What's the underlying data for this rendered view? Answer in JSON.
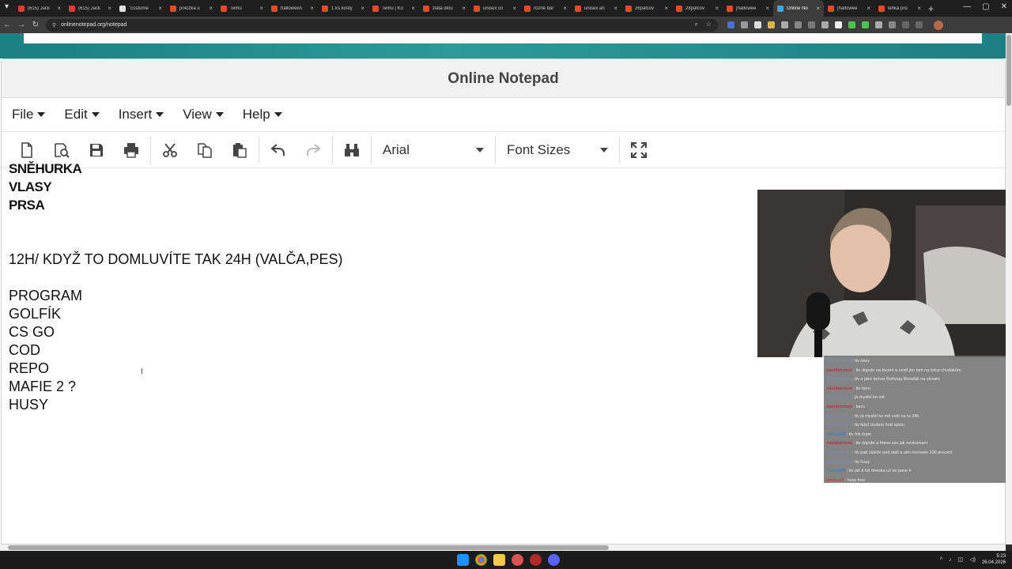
{
  "browser": {
    "tabs": [
      {
        "title": "(615) Jack",
        "color": "#e53935"
      },
      {
        "title": "(615) Jack",
        "color": "#e53935"
      },
      {
        "title": "\"costume",
        "color": "#e0e0e0"
      },
      {
        "title": "položka u",
        "color": "#e8472a"
      },
      {
        "title": "Temu",
        "color": "#e8472a"
      },
      {
        "title": "halloween",
        "color": "#e8472a"
      },
      {
        "title": "1 ks kostý",
        "color": "#e8472a"
      },
      {
        "title": "Temu | Ko",
        "color": "#e8472a"
      },
      {
        "title": "zlatá dlou",
        "color": "#e8472a"
      },
      {
        "title": "unisex co",
        "color": "#e8472a"
      },
      {
        "title": "různé bar",
        "color": "#e8472a"
      },
      {
        "title": "unisex an",
        "color": "#e8472a"
      },
      {
        "title": "26palcov",
        "color": "#e8472a"
      },
      {
        "title": "28palcov",
        "color": "#e8472a"
      },
      {
        "title": "[hallowee",
        "color": "#e8472a"
      },
      {
        "title": "Online No",
        "color": "#4aa3df",
        "active": true
      },
      {
        "title": "[hallowee",
        "color": "#e8472a"
      },
      {
        "title": "lehká pro",
        "color": "#e8472a"
      }
    ],
    "url": "onlinenotepad.org/notepad"
  },
  "notepad": {
    "title": "Online Notepad",
    "menu": [
      "File",
      "Edit",
      "Insert",
      "View",
      "Help"
    ],
    "font_select": "Arial",
    "size_select": "Font Sizes",
    "bold_lines": [
      "SNĚHURKA",
      "VLASY",
      "PRSA"
    ],
    "body_line": "12H/ KDYŽ TO DOMLUVÍTE TAK 24H (VALČA,PES)",
    "list": [
      "PROGRAM",
      "GOLFÍK",
      "CS GO",
      "COD",
      "REPO",
      "MAFIE 2 ?",
      "HUSY"
    ]
  },
  "chat": [
    {
      "user": "mrjohnskon",
      "msg": "ttv okey",
      "color": "#7a8ab0"
    },
    {
      "user": "davidekrizek",
      "msg": "ttv dojede na focení a uvidí jim tam na fotce chudákům",
      "color": "#c0304a"
    },
    {
      "user": "mrjohnskon",
      "msg": "ttv a jako bonus Bořivoja Blonďák na stream",
      "color": "#7a8ab0"
    },
    {
      "user": "davidekrizek",
      "msg": "ttv beru",
      "color": "#c0304a"
    },
    {
      "user": "mrjohnskon",
      "msg": "já myslel ke mě",
      "color": "#7a8ab0"
    },
    {
      "user": "davidekrizek",
      "msg": "beru",
      "color": "#c0304a"
    },
    {
      "user": "mrjohnskon",
      "msg": "ttv já myslel ke mě volé na tu 24h",
      "color": "#7a8ab0"
    },
    {
      "user": "mrjohnskon",
      "msg": "ttv když budem hrát spolu",
      "color": "#7a8ab0"
    },
    {
      "user": "Staby205",
      "msg": "ttv fnk šupe",
      "color": "#3f7fd0"
    },
    {
      "user": "davidekrizek",
      "msg": "ttv dojede a řekne sss jak nevkomaní",
      "color": "#c0304a"
    },
    {
      "user": "mrjohnskon",
      "msg": "ttv pak záleže pod stali a aim increase 100 procent",
      "color": "#7a8ab0"
    },
    {
      "user": "mrjohnskon",
      "msg": "ttv husy",
      "color": "#7a8ab0"
    },
    {
      "user": "Staby205",
      "msg": "ttv jak ti trá dneska už se pane F",
      "color": "#3f7fd0"
    },
    {
      "user": "jimmca2",
      "msg": "husy free",
      "color": "#d04040"
    }
  ],
  "taskbar": {
    "time": "5:23",
    "date": "26.04.2026"
  }
}
